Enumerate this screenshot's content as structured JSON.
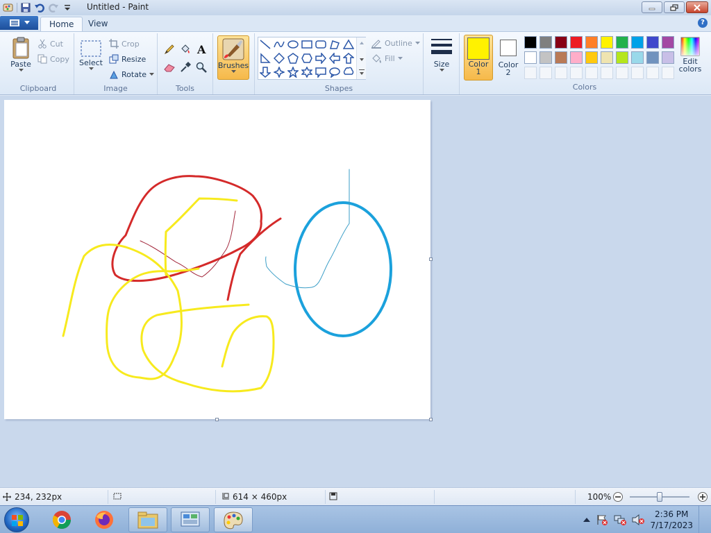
{
  "window": {
    "title": "Untitled - Paint"
  },
  "tabs": [
    {
      "label": "Home"
    },
    {
      "label": "View"
    }
  ],
  "ribbon": {
    "clipboard": {
      "label": "Clipboard",
      "paste": "Paste",
      "cut": "Cut",
      "copy": "Copy"
    },
    "image": {
      "label": "Image",
      "select": "Select",
      "crop": "Crop",
      "resize": "Resize",
      "rotate": "Rotate"
    },
    "tools": {
      "label": "Tools"
    },
    "brushes": {
      "label": "Brushes"
    },
    "shapes": {
      "label": "Shapes",
      "outline": "Outline",
      "fill": "Fill"
    },
    "size": {
      "label": "Size"
    },
    "colors": {
      "label": "Colors",
      "color1_line1": "Color",
      "color1_line2": "1",
      "color2_line1": "Color",
      "color2_line2": "2",
      "edit_line1": "Edit",
      "edit_line2": "colors",
      "color1": "#fff200",
      "color2": "#ffffff",
      "palette_row1": [
        "#000000",
        "#7f7f7f",
        "#880015",
        "#ed1c24",
        "#ff7f27",
        "#fff200",
        "#22b14c",
        "#00a2e8",
        "#3f48cc",
        "#a349a4"
      ],
      "palette_row2": [
        "#ffffff",
        "#c3c3c3",
        "#b97a57",
        "#ffaec9",
        "#ffc90e",
        "#efe4b0",
        "#b5e61d",
        "#99d9ea",
        "#7092be",
        "#c8bfe7"
      ]
    }
  },
  "status": {
    "cursor_pos": "234, 232px",
    "canvas_size": "614 × 460px",
    "zoom": "100%"
  },
  "taskbar": {
    "time": "2:36 PM",
    "date": "7/17/2023"
  },
  "drawing_colors": {
    "red": "#d42a2a",
    "yellow": "#f7ea1e",
    "blue": "#1ba1dc",
    "darkred": "#a3283c",
    "teal": "#3a9ec7"
  }
}
